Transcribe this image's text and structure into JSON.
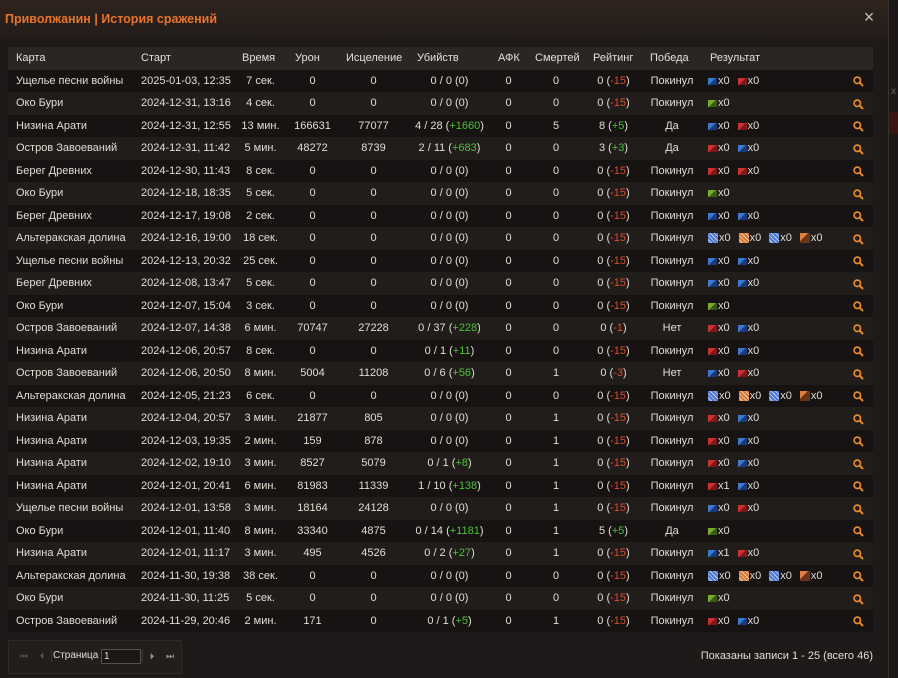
{
  "window": {
    "title": "Приволжанин | История сражений",
    "close_label": "×"
  },
  "columns": [
    "Карта",
    "Старт",
    "Время",
    "Урон",
    "Исцеление",
    "Убийств",
    "АФК",
    "Смертей",
    "Рейтинг",
    "Победа",
    "Результат"
  ],
  "rows": [
    {
      "map": "Ущелье песни войны",
      "start": "2025-01-03, 12:35",
      "time": "7 сек.",
      "damage": "0",
      "heal": "0",
      "kills": "0 / 0 (",
      "kills_delta": "0",
      "kills_end": ")",
      "kd_class": "",
      "afk": "0",
      "deaths": "0",
      "rating": "0 (",
      "rating_delta": "-15",
      "rating_end": ")",
      "rd_class": "neg",
      "win": "Покинул",
      "flags": [
        {
          "color": "blue",
          "count": "x0"
        },
        {
          "color": "red",
          "count": "x0"
        }
      ]
    },
    {
      "map": "Око Бури",
      "start": "2024-12-31, 13:16",
      "time": "4 сек.",
      "damage": "0",
      "heal": "0",
      "kills": "0 / 0 (",
      "kills_delta": "0",
      "kills_end": ")",
      "kd_class": "",
      "afk": "0",
      "deaths": "0",
      "rating": "0 (",
      "rating_delta": "-15",
      "rating_end": ")",
      "rd_class": "neg",
      "win": "Покинул",
      "flags": [
        {
          "color": "green",
          "count": "x0"
        }
      ]
    },
    {
      "map": "Низина Арати",
      "start": "2024-12-31, 12:55",
      "time": "13 мин.",
      "damage": "166631",
      "heal": "77077",
      "kills": "4 / 28 (",
      "kills_delta": "+1660",
      "kills_end": ")",
      "kd_class": "pos",
      "afk": "0",
      "deaths": "5",
      "rating": "8 (",
      "rating_delta": "+5",
      "rating_end": ")",
      "rd_class": "pos",
      "win": "Да",
      "flags": [
        {
          "color": "blue",
          "count": "x0"
        },
        {
          "color": "red",
          "count": "x0"
        }
      ]
    },
    {
      "map": "Остров Завоеваний",
      "start": "2024-12-31, 11:42",
      "time": "5 мин.",
      "damage": "48272",
      "heal": "8739",
      "kills": "2 / 11 (",
      "kills_delta": "+683",
      "kills_end": ")",
      "kd_class": "pos",
      "afk": "0",
      "deaths": "0",
      "rating": "3 (",
      "rating_delta": "+3",
      "rating_end": ")",
      "rd_class": "pos",
      "win": "Да",
      "flags": [
        {
          "color": "red",
          "count": "x0"
        },
        {
          "color": "blue",
          "count": "x0"
        }
      ]
    },
    {
      "map": "Берег Древних",
      "start": "2024-12-30, 11:43",
      "time": "8 сек.",
      "damage": "0",
      "heal": "0",
      "kills": "0 / 0 (",
      "kills_delta": "0",
      "kills_end": ")",
      "kd_class": "",
      "afk": "0",
      "deaths": "0",
      "rating": "0 (",
      "rating_delta": "-15",
      "rating_end": ")",
      "rd_class": "neg",
      "win": "Покинул",
      "flags": [
        {
          "color": "red",
          "count": "x0"
        },
        {
          "color": "red",
          "count": "x0"
        }
      ]
    },
    {
      "map": "Око Бури",
      "start": "2024-12-18, 18:35",
      "time": "5 сек.",
      "damage": "0",
      "heal": "0",
      "kills": "0 / 0 (",
      "kills_delta": "0",
      "kills_end": ")",
      "kd_class": "",
      "afk": "0",
      "deaths": "0",
      "rating": "0 (",
      "rating_delta": "-15",
      "rating_end": ")",
      "rd_class": "neg",
      "win": "Покинул",
      "flags": [
        {
          "color": "green",
          "count": "x0"
        }
      ]
    },
    {
      "map": "Берег Древних",
      "start": "2024-12-17, 19:08",
      "time": "2 сек.",
      "damage": "0",
      "heal": "0",
      "kills": "0 / 0 (",
      "kills_delta": "0",
      "kills_end": ")",
      "kd_class": "",
      "afk": "0",
      "deaths": "0",
      "rating": "0 (",
      "rating_delta": "-15",
      "rating_end": ")",
      "rd_class": "neg",
      "win": "Покинул",
      "flags": [
        {
          "color": "blue",
          "count": "x0"
        },
        {
          "color": "blue",
          "count": "x0"
        }
      ]
    },
    {
      "map": "Альтеракская долина",
      "start": "2024-12-16, 19:00",
      "time": "18 сек.",
      "damage": "0",
      "heal": "0",
      "kills": "0 / 0 (",
      "kills_delta": "0",
      "kills_end": ")",
      "kd_class": "",
      "afk": "0",
      "deaths": "0",
      "rating": "0 (",
      "rating_delta": "-15",
      "rating_end": ")",
      "rd_class": "neg",
      "win": "Покинул",
      "flags": [
        {
          "color": "tile-blue",
          "count": "x0"
        },
        {
          "color": "tile-orange",
          "count": "x0"
        },
        {
          "color": "tile-blue",
          "count": "x0"
        },
        {
          "color": "tile-orange2",
          "count": "x0"
        }
      ]
    },
    {
      "map": "Ущелье песни войны",
      "start": "2024-12-13, 20:32",
      "time": "25 сек.",
      "damage": "0",
      "heal": "0",
      "kills": "0 / 0 (",
      "kills_delta": "0",
      "kills_end": ")",
      "kd_class": "",
      "afk": "0",
      "deaths": "0",
      "rating": "0 (",
      "rating_delta": "-15",
      "rating_end": ")",
      "rd_class": "neg",
      "win": "Покинул",
      "flags": [
        {
          "color": "blue",
          "count": "x0"
        },
        {
          "color": "blue",
          "count": "x0"
        }
      ]
    },
    {
      "map": "Берег Древних",
      "start": "2024-12-08, 13:47",
      "time": "5 сек.",
      "damage": "0",
      "heal": "0",
      "kills": "0 / 0 (",
      "kills_delta": "0",
      "kills_end": ")",
      "kd_class": "",
      "afk": "0",
      "deaths": "0",
      "rating": "0 (",
      "rating_delta": "-15",
      "rating_end": ")",
      "rd_class": "neg",
      "win": "Покинул",
      "flags": [
        {
          "color": "blue",
          "count": "x0"
        },
        {
          "color": "blue",
          "count": "x0"
        }
      ]
    },
    {
      "map": "Око Бури",
      "start": "2024-12-07, 15:04",
      "time": "3 сек.",
      "damage": "0",
      "heal": "0",
      "kills": "0 / 0 (",
      "kills_delta": "0",
      "kills_end": ")",
      "kd_class": "",
      "afk": "0",
      "deaths": "0",
      "rating": "0 (",
      "rating_delta": "-15",
      "rating_end": ")",
      "rd_class": "neg",
      "win": "Покинул",
      "flags": [
        {
          "color": "green",
          "count": "x0"
        }
      ]
    },
    {
      "map": "Остров Завоеваний",
      "start": "2024-12-07, 14:38",
      "time": "6 мин.",
      "damage": "70747",
      "heal": "27228",
      "kills": "0 / 37 (",
      "kills_delta": "+228",
      "kills_end": ")",
      "kd_class": "pos",
      "afk": "0",
      "deaths": "0",
      "rating": "0 (",
      "rating_delta": "-1",
      "rating_end": ")",
      "rd_class": "neg",
      "win": "Нет",
      "flags": [
        {
          "color": "red",
          "count": "x0"
        },
        {
          "color": "blue",
          "count": "x0"
        }
      ]
    },
    {
      "map": "Низина Арати",
      "start": "2024-12-06, 20:57",
      "time": "8 сек.",
      "damage": "0",
      "heal": "0",
      "kills": "0 / 1 (",
      "kills_delta": "+11",
      "kills_end": ")",
      "kd_class": "pos",
      "afk": "0",
      "deaths": "0",
      "rating": "0 (",
      "rating_delta": "-15",
      "rating_end": ")",
      "rd_class": "neg",
      "win": "Покинул",
      "flags": [
        {
          "color": "red",
          "count": "x0"
        },
        {
          "color": "blue",
          "count": "x0"
        }
      ]
    },
    {
      "map": "Остров Завоеваний",
      "start": "2024-12-06, 20:50",
      "time": "8 мин.",
      "damage": "5004",
      "heal": "11208",
      "kills": "0 / 6 (",
      "kills_delta": "+56",
      "kills_end": ")",
      "kd_class": "pos",
      "afk": "0",
      "deaths": "1",
      "rating": "0 (",
      "rating_delta": "-3",
      "rating_end": ")",
      "rd_class": "neg",
      "win": "Нет",
      "flags": [
        {
          "color": "blue",
          "count": "x0"
        },
        {
          "color": "red",
          "count": "x0"
        }
      ]
    },
    {
      "map": "Альтеракская долина",
      "start": "2024-12-05, 21:23",
      "time": "6 сек.",
      "damage": "0",
      "heal": "0",
      "kills": "0 / 0 (",
      "kills_delta": "0",
      "kills_end": ")",
      "kd_class": "",
      "afk": "0",
      "deaths": "0",
      "rating": "0 (",
      "rating_delta": "-15",
      "rating_end": ")",
      "rd_class": "neg",
      "win": "Покинул",
      "flags": [
        {
          "color": "tile-blue",
          "count": "x0"
        },
        {
          "color": "tile-orange",
          "count": "x0"
        },
        {
          "color": "tile-blue",
          "count": "x0"
        },
        {
          "color": "tile-orange2",
          "count": "x0"
        }
      ]
    },
    {
      "map": "Низина Арати",
      "start": "2024-12-04, 20:57",
      "time": "3 мин.",
      "damage": "21877",
      "heal": "805",
      "kills": "0 / 0 (",
      "kills_delta": "0",
      "kills_end": ")",
      "kd_class": "",
      "afk": "0",
      "deaths": "1",
      "rating": "0 (",
      "rating_delta": "-15",
      "rating_end": ")",
      "rd_class": "neg",
      "win": "Покинул",
      "flags": [
        {
          "color": "red",
          "count": "x0"
        },
        {
          "color": "blue",
          "count": "x0"
        }
      ]
    },
    {
      "map": "Низина Арати",
      "start": "2024-12-03, 19:35",
      "time": "2 мин.",
      "damage": "159",
      "heal": "878",
      "kills": "0 / 0 (",
      "kills_delta": "0",
      "kills_end": ")",
      "kd_class": "",
      "afk": "0",
      "deaths": "1",
      "rating": "0 (",
      "rating_delta": "-15",
      "rating_end": ")",
      "rd_class": "neg",
      "win": "Покинул",
      "flags": [
        {
          "color": "red",
          "count": "x0"
        },
        {
          "color": "blue",
          "count": "x0"
        }
      ]
    },
    {
      "map": "Низина Арати",
      "start": "2024-12-02, 19:10",
      "time": "3 мин.",
      "damage": "8527",
      "heal": "5079",
      "kills": "0 / 1 (",
      "kills_delta": "+8",
      "kills_end": ")",
      "kd_class": "pos",
      "afk": "0",
      "deaths": "1",
      "rating": "0 (",
      "rating_delta": "-15",
      "rating_end": ")",
      "rd_class": "neg",
      "win": "Покинул",
      "flags": [
        {
          "color": "red",
          "count": "x0"
        },
        {
          "color": "blue",
          "count": "x0"
        }
      ]
    },
    {
      "map": "Низина Арати",
      "start": "2024-12-01, 20:41",
      "time": "6 мин.",
      "damage": "81983",
      "heal": "11339",
      "kills": "1 / 10 (",
      "kills_delta": "+138",
      "kills_end": ")",
      "kd_class": "pos",
      "afk": "0",
      "deaths": "1",
      "rating": "0 (",
      "rating_delta": "-15",
      "rating_end": ")",
      "rd_class": "neg",
      "win": "Покинул",
      "flags": [
        {
          "color": "red",
          "count": "x1"
        },
        {
          "color": "blue",
          "count": "x0"
        }
      ]
    },
    {
      "map": "Ущелье песни войны",
      "start": "2024-12-01, 13:58",
      "time": "3 мин.",
      "damage": "18164",
      "heal": "24128",
      "kills": "0 / 0 (",
      "kills_delta": "0",
      "kills_end": ")",
      "kd_class": "",
      "afk": "0",
      "deaths": "1",
      "rating": "0 (",
      "rating_delta": "-15",
      "rating_end": ")",
      "rd_class": "neg",
      "win": "Покинул",
      "flags": [
        {
          "color": "blue",
          "count": "x0"
        },
        {
          "color": "red",
          "count": "x0"
        }
      ]
    },
    {
      "map": "Око Бури",
      "start": "2024-12-01, 11:40",
      "time": "8 мин.",
      "damage": "33340",
      "heal": "4875",
      "kills": "0 / 14 (",
      "kills_delta": "+1181",
      "kills_end": ")",
      "kd_class": "pos",
      "afk": "0",
      "deaths": "1",
      "rating": "5 (",
      "rating_delta": "+5",
      "rating_end": ")",
      "rd_class": "pos",
      "win": "Да",
      "flags": [
        {
          "color": "green",
          "count": "x0"
        }
      ]
    },
    {
      "map": "Низина Арати",
      "start": "2024-12-01, 11:17",
      "time": "3 мин.",
      "damage": "495",
      "heal": "4526",
      "kills": "0 / 2 (",
      "kills_delta": "+27",
      "kills_end": ")",
      "kd_class": "pos",
      "afk": "0",
      "deaths": "1",
      "rating": "0 (",
      "rating_delta": "-15",
      "rating_end": ")",
      "rd_class": "neg",
      "win": "Покинул",
      "flags": [
        {
          "color": "blue",
          "count": "x1"
        },
        {
          "color": "red",
          "count": "x0"
        }
      ]
    },
    {
      "map": "Альтеракская долина",
      "start": "2024-11-30, 19:38",
      "time": "38 сек.",
      "damage": "0",
      "heal": "0",
      "kills": "0 / 0 (",
      "kills_delta": "0",
      "kills_end": ")",
      "kd_class": "",
      "afk": "0",
      "deaths": "0",
      "rating": "0 (",
      "rating_delta": "-15",
      "rating_end": ")",
      "rd_class": "neg",
      "win": "Покинул",
      "flags": [
        {
          "color": "tile-blue",
          "count": "x0"
        },
        {
          "color": "tile-orange",
          "count": "x0"
        },
        {
          "color": "tile-blue",
          "count": "x0"
        },
        {
          "color": "tile-orange2",
          "count": "x0"
        }
      ]
    },
    {
      "map": "Око Бури",
      "start": "2024-11-30, 11:25",
      "time": "5 сек.",
      "damage": "0",
      "heal": "0",
      "kills": "0 / 0 (",
      "kills_delta": "0",
      "kills_end": ")",
      "kd_class": "",
      "afk": "0",
      "deaths": "0",
      "rating": "0 (",
      "rating_delta": "-15",
      "rating_end": ")",
      "rd_class": "neg",
      "win": "Покинул",
      "flags": [
        {
          "color": "green",
          "count": "x0"
        }
      ]
    },
    {
      "map": "Остров Завоеваний",
      "start": "2024-11-29, 20:46",
      "time": "2 мин.",
      "damage": "171",
      "heal": "0",
      "kills": "0 / 1 (",
      "kills_delta": "+5",
      "kills_end": ")",
      "kd_class": "pos",
      "afk": "0",
      "deaths": "1",
      "rating": "0 (",
      "rating_delta": "-15",
      "rating_end": ")",
      "rd_class": "neg",
      "win": "Покинул",
      "flags": [
        {
          "color": "red",
          "count": "x0"
        },
        {
          "color": "blue",
          "count": "x0"
        }
      ]
    }
  ],
  "pager": {
    "page_label": "Страница",
    "page_value": "1"
  },
  "status": "Показаны записи 1 - 25 (всего 46)",
  "colors": {
    "accent": "#e8742a",
    "positive": "#4cc13a",
    "negative": "#e04a2a",
    "magnifier": "#e68a2e"
  },
  "icons": {
    "details": "magnifier-icon",
    "close": "close-icon"
  }
}
